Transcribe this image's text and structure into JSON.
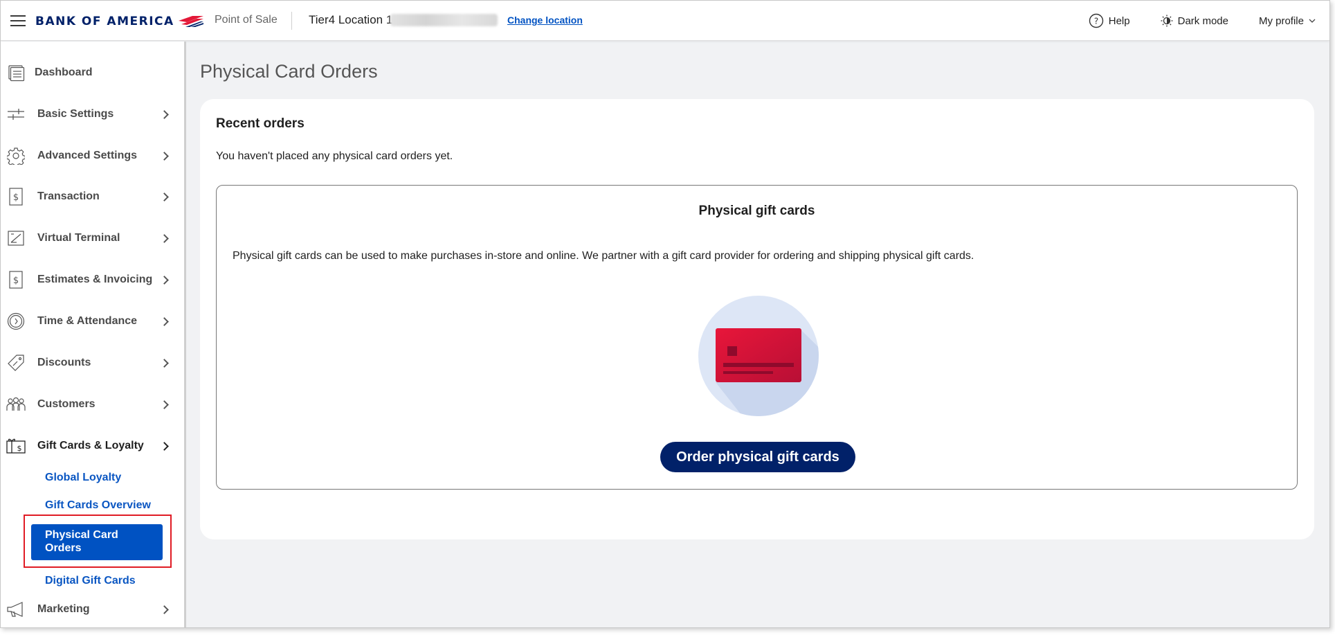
{
  "header": {
    "brand": "BANK OF AMERICA",
    "app_name": "Point of Sale",
    "location": "Tier4 Location 1",
    "change_location": "Change location",
    "help": "Help",
    "dark_mode": "Dark mode",
    "my_profile": "My profile"
  },
  "sidebar": {
    "items": [
      {
        "label": "Dashboard",
        "icon": "dashboard-icon"
      },
      {
        "label": "Basic Settings",
        "icon": "sliders-icon"
      },
      {
        "label": "Advanced Settings",
        "icon": "gear-icon"
      },
      {
        "label": "Transaction",
        "icon": "receipt-dollar-icon"
      },
      {
        "label": "Virtual Terminal",
        "icon": "terminal-icon"
      },
      {
        "label": "Estimates & Invoicing",
        "icon": "invoice-dollar-icon"
      },
      {
        "label": "Time & Attendance",
        "icon": "clock-icon"
      },
      {
        "label": "Discounts",
        "icon": "tag-icon"
      },
      {
        "label": "Customers",
        "icon": "people-icon"
      },
      {
        "label": "Gift Cards & Loyalty",
        "icon": "gift-card-icon"
      },
      {
        "label": "Marketing",
        "icon": "megaphone-icon"
      }
    ],
    "sub_items": [
      {
        "label": "Global Loyalty"
      },
      {
        "label": "Gift Cards Overview"
      },
      {
        "label": "Physical Card Orders",
        "active": true
      },
      {
        "label": "Digital Gift Cards"
      }
    ]
  },
  "main": {
    "page_title": "Physical Card Orders",
    "recent_title": "Recent orders",
    "recent_empty": "You haven't placed any physical card orders yet.",
    "gift_title": "Physical gift cards",
    "gift_desc": "Physical gift cards can be used to make purchases in-store and online. We partner with a gift card provider for ordering and shipping physical gift cards.",
    "order_button": "Order physical gift cards"
  },
  "colors": {
    "brand_navy": "#012169",
    "brand_red": "#e31837",
    "active_blue": "#0052c2",
    "highlight_red": "#e01b24"
  }
}
